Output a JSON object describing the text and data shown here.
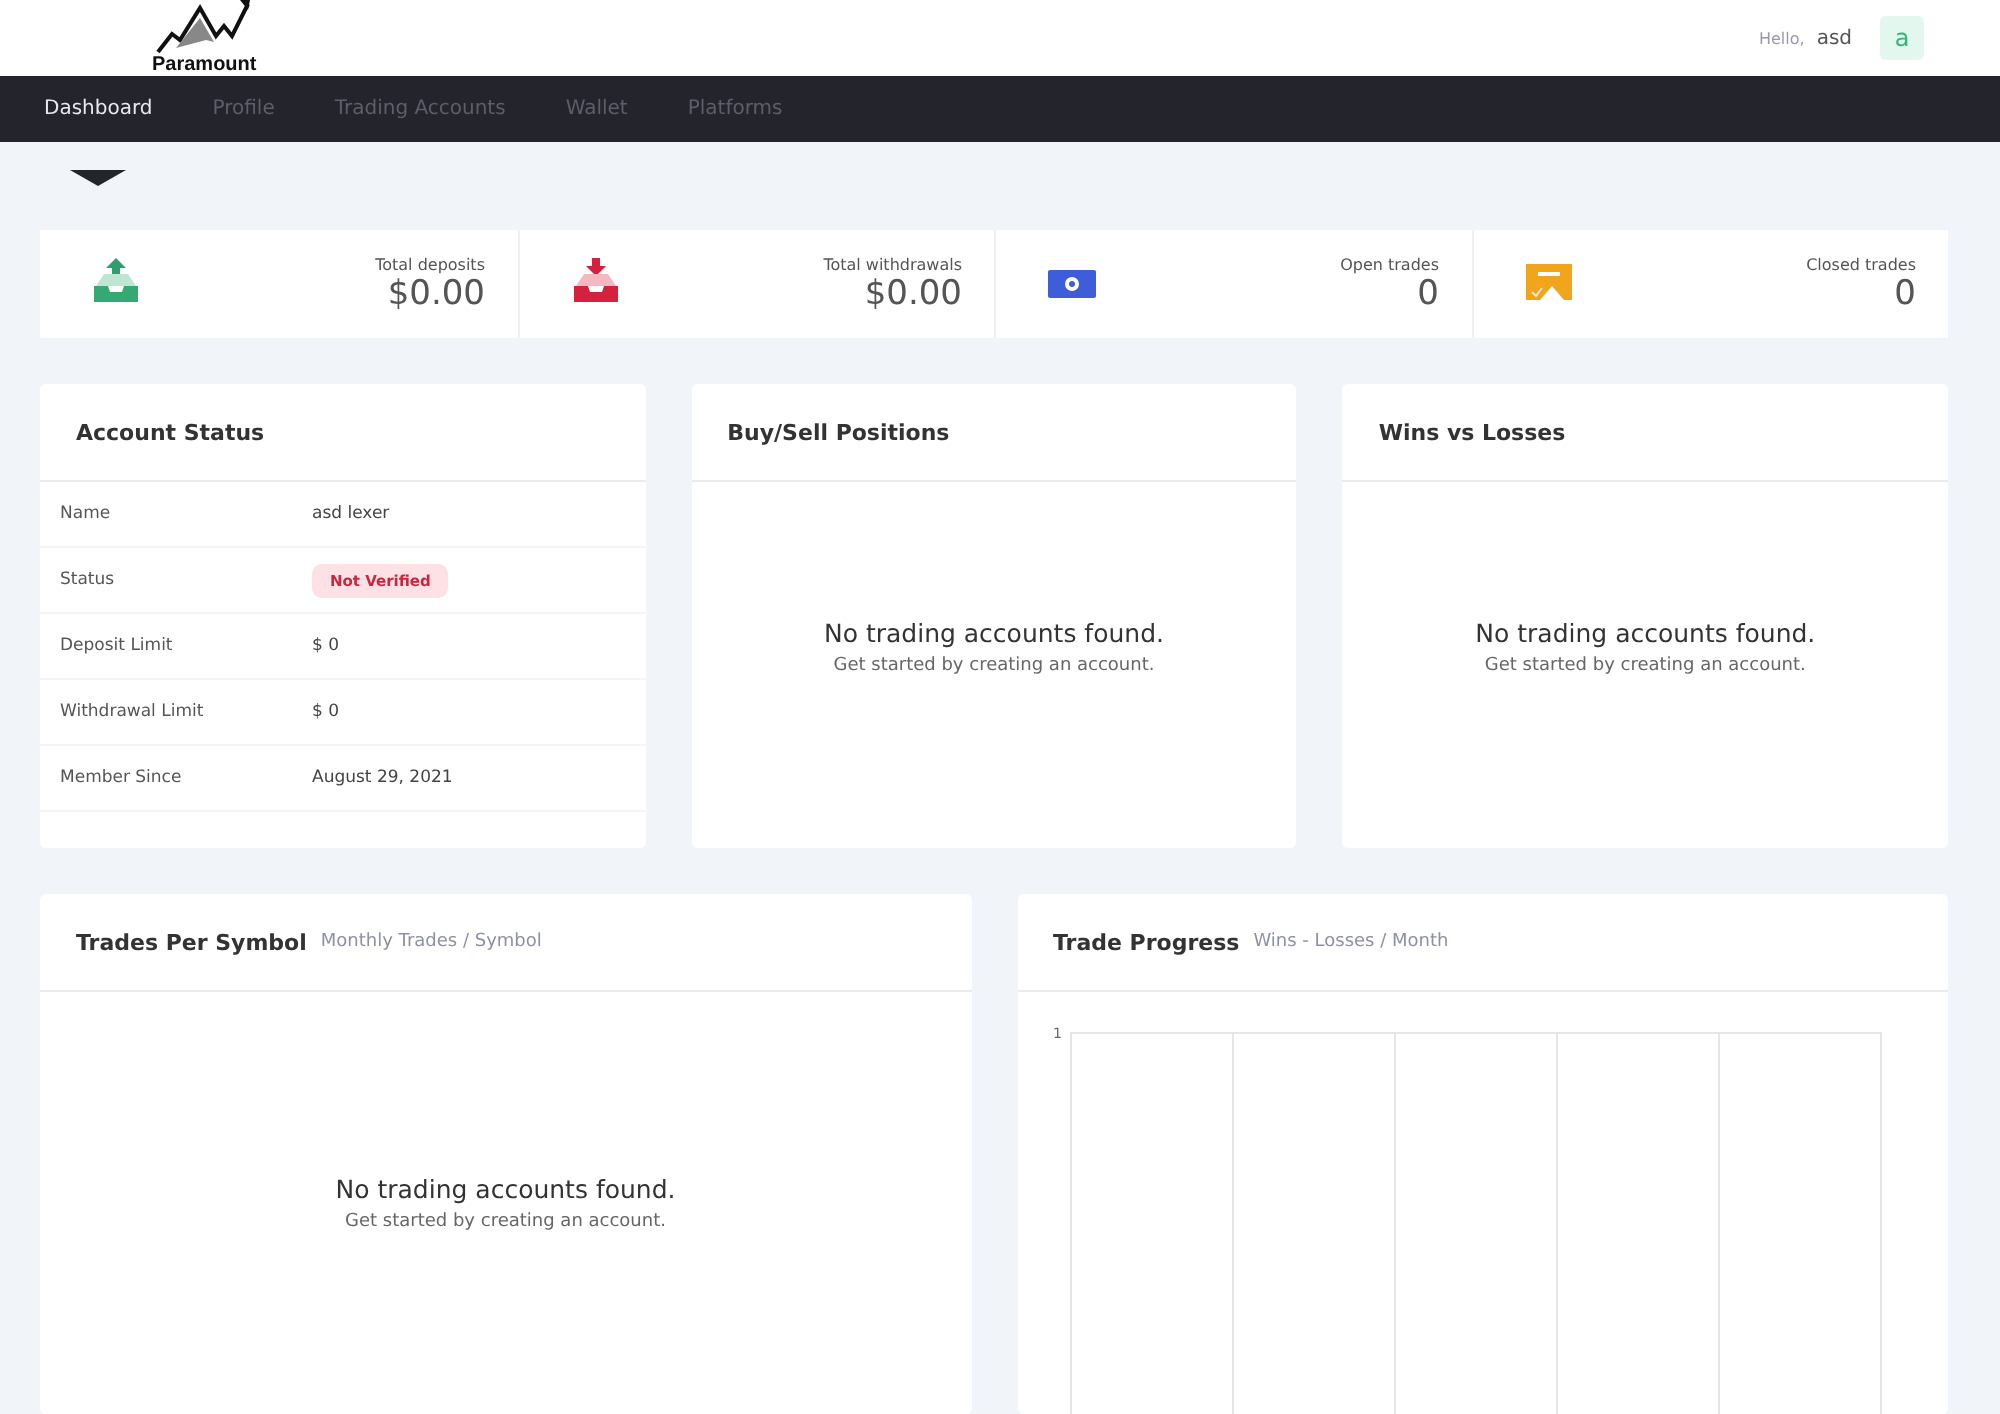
{
  "header": {
    "logo_text": "Paramount",
    "greeting": "Hello,",
    "username": "asd",
    "avatar_letter": "a"
  },
  "nav": [
    {
      "label": "Dashboard",
      "selected": true
    },
    {
      "label": "Profile",
      "selected": false
    },
    {
      "label": "Trading Accounts",
      "selected": false
    },
    {
      "label": "Wallet",
      "selected": false
    },
    {
      "label": "Platforms",
      "selected": false
    }
  ],
  "stats": [
    {
      "kind": "deposit",
      "label": "Total deposits",
      "value": "$0.00"
    },
    {
      "kind": "withdrawal",
      "label": "Total withdrawals",
      "value": "$0.00"
    },
    {
      "kind": "open",
      "label": "Open trades",
      "value": "0"
    },
    {
      "kind": "closed",
      "label": "Closed trades",
      "value": "0"
    }
  ],
  "account_status": {
    "title": "Account Status",
    "rows": [
      {
        "kind": "text",
        "label": "Name",
        "value": "asd lexer"
      },
      {
        "kind": "badge",
        "label": "Status",
        "value": "Not Verified"
      },
      {
        "kind": "text",
        "label": "Deposit Limit",
        "value": "$ 0"
      },
      {
        "kind": "text",
        "label": "Withdrawal Limit",
        "value": "$ 0"
      },
      {
        "kind": "text",
        "label": "Member Since",
        "value": "August 29, 2021"
      }
    ]
  },
  "positions": {
    "title": "Buy/Sell Positions",
    "empty_title": "No trading accounts found.",
    "empty_text": "Get started by creating an account."
  },
  "wins_losses": {
    "title": "Wins vs Losses",
    "empty_title": "No trading accounts found.",
    "empty_text": "Get started by creating an account."
  },
  "trades_per_symbol": {
    "title": "Trades Per Symbol",
    "subtitle": "Monthly Trades / Symbol",
    "empty_title": "No trading accounts found.",
    "empty_text": "Get started by creating an account."
  },
  "trade_progress": {
    "title": "Trade Progress",
    "subtitle": "Wins - Losses / Month",
    "y_tick": "1"
  }
}
